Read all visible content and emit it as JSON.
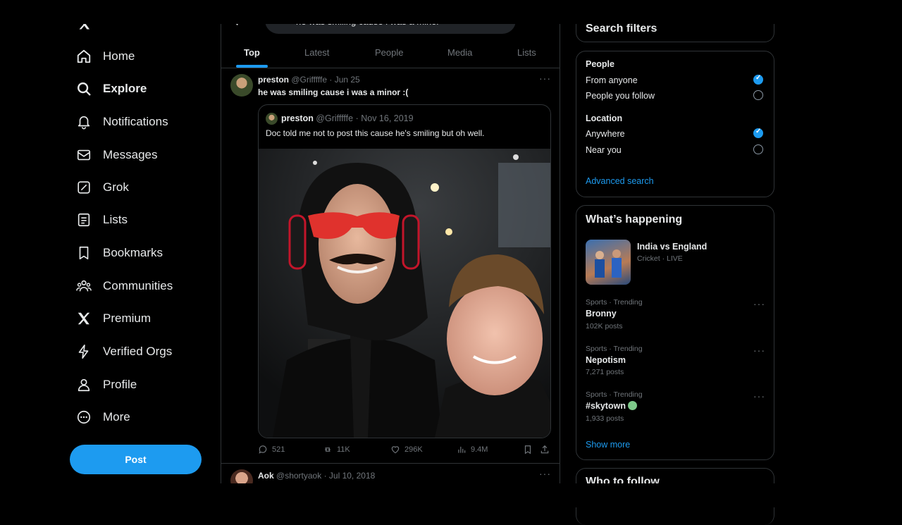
{
  "nav": {
    "items": [
      {
        "label": "Home",
        "icon": "home-icon"
      },
      {
        "label": "Explore",
        "icon": "search-icon",
        "active": true
      },
      {
        "label": "Notifications",
        "icon": "bell-icon"
      },
      {
        "label": "Messages",
        "icon": "envelope-icon"
      },
      {
        "label": "Grok",
        "icon": "grok-icon"
      },
      {
        "label": "Lists",
        "icon": "list-icon"
      },
      {
        "label": "Bookmarks",
        "icon": "bookmark-icon"
      },
      {
        "label": "Communities",
        "icon": "communities-icon"
      },
      {
        "label": "Premium",
        "icon": "x-logo-icon"
      },
      {
        "label": "Verified Orgs",
        "icon": "lightning-icon"
      },
      {
        "label": "Profile",
        "icon": "person-icon"
      },
      {
        "label": "More",
        "icon": "more-circle-icon"
      }
    ],
    "post_label": "Post"
  },
  "search": {
    "query": "he was smiling cause i was a minor"
  },
  "tabs": [
    "Top",
    "Latest",
    "People",
    "Media",
    "Lists"
  ],
  "tweet": {
    "name": "preston",
    "handle": "@Grifffffe",
    "date": "· Jun 25",
    "text": "he was smiling cause i was a minor :(",
    "quote": {
      "name": "preston",
      "handle": "@Grifffffe",
      "date": "· Nov 16, 2019",
      "text": "Doc told me not to post this cause he's smiling but oh well."
    },
    "stats": {
      "replies": "521",
      "reposts": "11K",
      "likes": "296K",
      "views": "9.4M"
    }
  },
  "next_tweet": {
    "name": "Aok",
    "handle": "@shortyaok",
    "date": "· Jul 10, 2018"
  },
  "filters": {
    "title": "Search filters",
    "people_label": "People",
    "from_anyone": "From anyone",
    "people_you_follow": "People you follow",
    "location_label": "Location",
    "anywhere": "Anywhere",
    "near_you": "Near you",
    "advanced": "Advanced search"
  },
  "happening": {
    "title": "What’s happening",
    "featured": {
      "title": "India vs England",
      "meta": "Cricket · LIVE"
    },
    "trends": [
      {
        "meta": "Sports · Trending",
        "name": "Bronny",
        "posts": "102K posts"
      },
      {
        "meta": "Sports · Trending",
        "name": "Nepotism",
        "posts": "7,271 posts"
      },
      {
        "meta": "Sports · Trending",
        "name": "#skytown",
        "posts": "1,933 posts"
      }
    ],
    "show_more": "Show more"
  },
  "who_to_follow": {
    "title": "Who to follow"
  },
  "colors": {
    "accent": "#1d9bf0",
    "background": "#000000",
    "border": "#2f3336",
    "muted": "#71767b"
  }
}
